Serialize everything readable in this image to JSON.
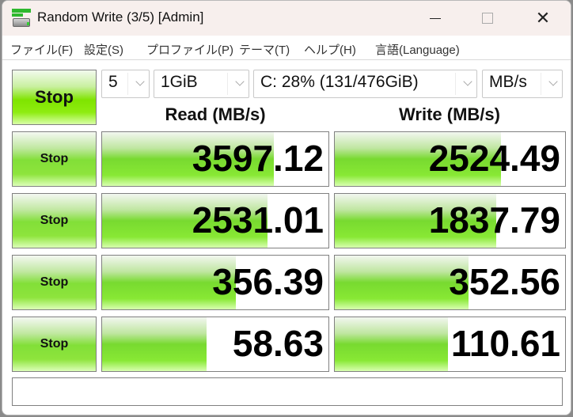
{
  "window": {
    "title": "Random Write (3/5) [Admin]",
    "icon": "disk-icon",
    "controls": {
      "minimize": "minimize-icon",
      "maximize": "maximize-icon",
      "close": "close-icon",
      "close_glyph": "✕"
    }
  },
  "menu": [
    {
      "label": "ファイル(F)"
    },
    {
      "label": "設定(S)"
    },
    {
      "label": "プロファイル(P)"
    },
    {
      "label": "テーマ(T)"
    },
    {
      "label": "ヘルプ(H)"
    },
    {
      "label": "言語(Language)"
    }
  ],
  "controls": {
    "main_button": "Stop",
    "count_select": "5",
    "size_select": "1GiB",
    "drive_select": "C: 28% (131/476GiB)",
    "unit_select": "MB/s"
  },
  "headers": {
    "read": "Read (MB/s)",
    "write": "Write (MB/s)"
  },
  "rows": [
    {
      "button": "Stop",
      "read": "3597.12",
      "read_fraction": 0.76,
      "write": "2524.49",
      "write_fraction": 0.72
    },
    {
      "button": "Stop",
      "read": "2531.01",
      "read_fraction": 0.73,
      "write": "1837.79",
      "write_fraction": 0.7
    },
    {
      "button": "Stop",
      "read": "356.39",
      "read_fraction": 0.59,
      "write": "352.56",
      "write_fraction": 0.58
    },
    {
      "button": "Stop",
      "read": "58.63",
      "read_fraction": 0.46,
      "write": "110.61",
      "write_fraction": 0.49
    }
  ],
  "status_text": "",
  "colors": {
    "accent_green": "#7fe400",
    "bar_green": "#78da30",
    "border": "#808080"
  }
}
